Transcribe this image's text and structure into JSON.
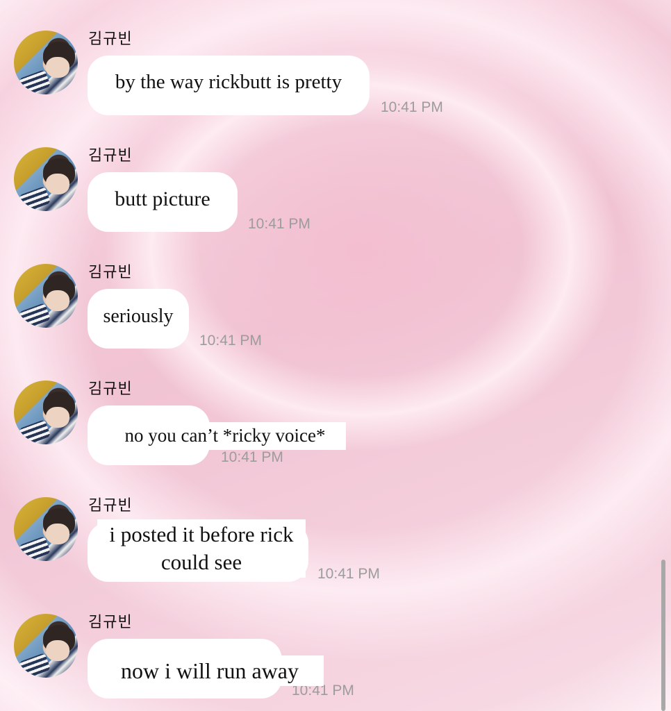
{
  "sender": "김규빈",
  "messages": [
    {
      "text": "by the way rickbutt is pretty",
      "time": "10:41 PM"
    },
    {
      "text": "butt picture",
      "time": "10:41 PM"
    },
    {
      "text": "seriously",
      "time": "10:41 PM"
    },
    {
      "text": "no you can’t *ricky voice*",
      "time": "10:41 PM"
    },
    {
      "text": "i posted it before rick could see",
      "time": "10:41 PM"
    },
    {
      "text": "now i will run away",
      "time": "10:41 PM"
    }
  ],
  "icons": {
    "avatar": "avatar-photo"
  },
  "colors": {
    "bubble": "#ffffff",
    "timestamp": "#9c9c9c",
    "background": "#f3cfdb"
  }
}
